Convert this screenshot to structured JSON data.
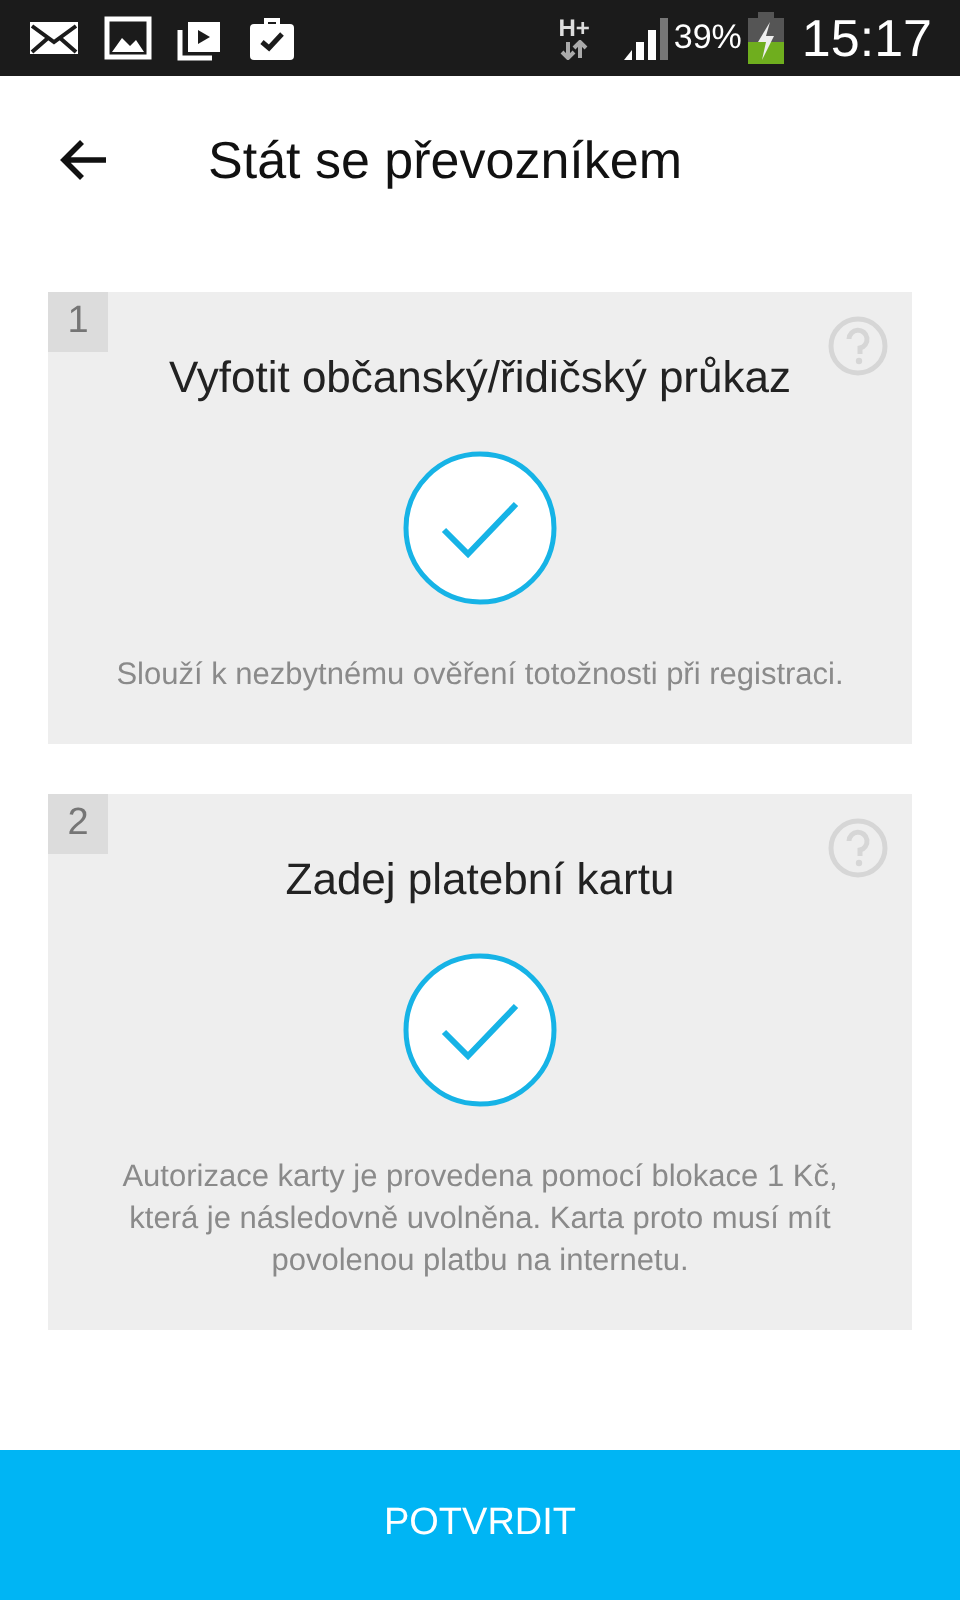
{
  "status_bar": {
    "network": "H+",
    "battery": "39%",
    "time": "15:17"
  },
  "header": {
    "title": "Stát se převozníkem"
  },
  "steps": [
    {
      "number": "1",
      "title": "Vyfotit občanský/řidičský průkaz",
      "completed": true,
      "description": "Slouží k nezbytnému ověření totožnosti při registraci."
    },
    {
      "number": "2",
      "title": "Zadej platební kartu",
      "completed": true,
      "description": "Autorizace karty je provedena pomocí blokace 1 Kč, která je následovně uvolněna. Karta proto musí mít povolenou platbu na internetu."
    }
  ],
  "confirm_button": "POTVRDIT"
}
